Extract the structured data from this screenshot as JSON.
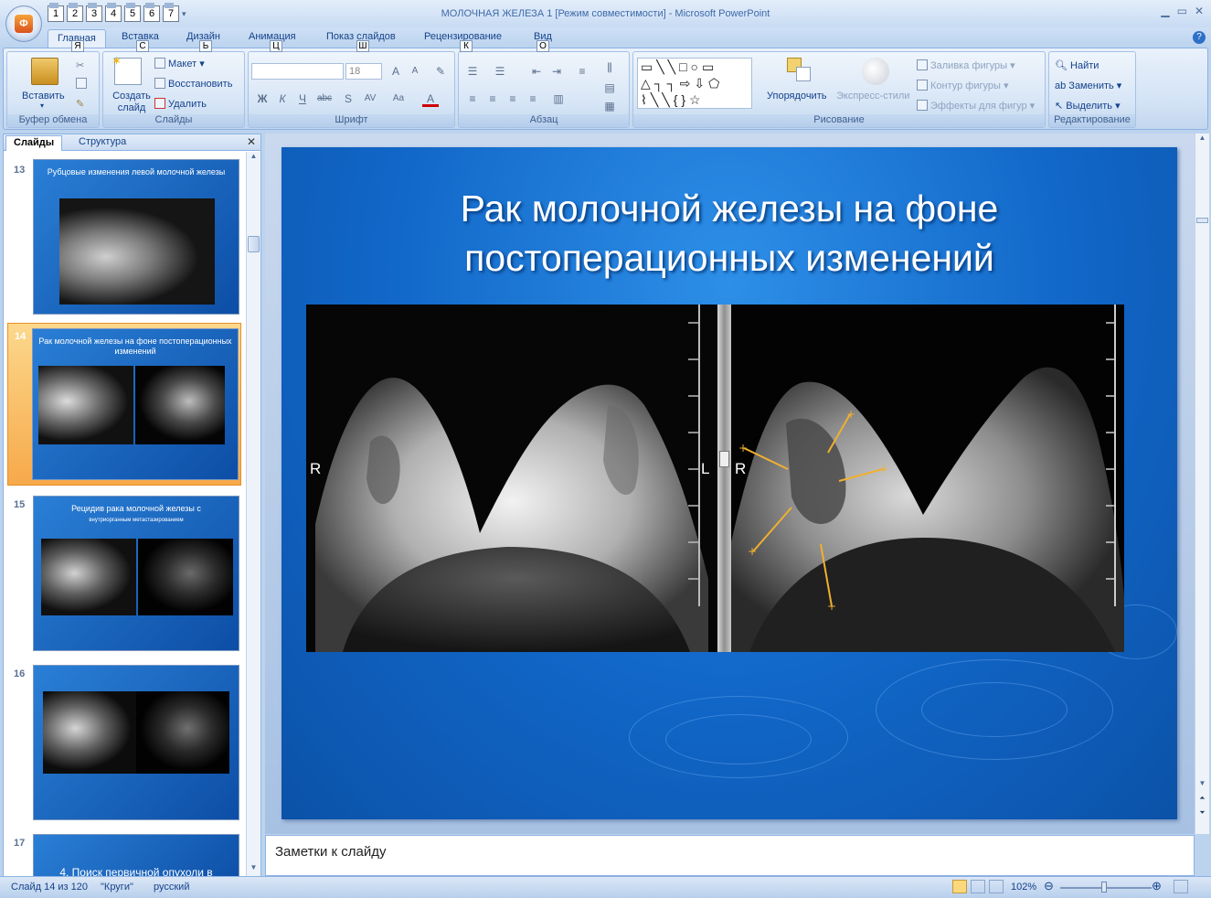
{
  "window": {
    "title": "МОЛОЧНАЯ ЖЕЛЕЗА 1 [Режим совместимости] - Microsoft PowerPoint"
  },
  "qat": {
    "keys": [
      "1",
      "2",
      "3",
      "4",
      "5",
      "6",
      "7"
    ]
  },
  "tabs": [
    {
      "label": "Главная",
      "key": "Я",
      "active": true
    },
    {
      "label": "Вставка",
      "key": "С"
    },
    {
      "label": "Дизайн",
      "key": "Ь"
    },
    {
      "label": "Анимация",
      "key": "Ц"
    },
    {
      "label": "Показ слайдов",
      "key": "Ш"
    },
    {
      "label": "Рецензирование",
      "key": "К"
    },
    {
      "label": "Вид",
      "key": "О"
    }
  ],
  "ribbon": {
    "clipboard": {
      "paste": "Вставить",
      "label": "Буфер обмена"
    },
    "slides": {
      "new_slide": "Создать слайд",
      "layout": "Макет",
      "reset": "Восстановить",
      "delete": "Удалить",
      "label": "Слайды"
    },
    "font": {
      "size": "18",
      "label": "Шрифт"
    },
    "paragraph": {
      "label": "Абзац"
    },
    "drawing": {
      "arrange": "Упорядочить",
      "quick_styles": "Экспресс-стили",
      "fill": "Заливка фигуры",
      "outline": "Контур фигуры",
      "effects": "Эффекты для фигур",
      "label": "Рисование"
    },
    "editing": {
      "find": "Найти",
      "replace": "Заменить",
      "select": "Выделить",
      "label": "Редактирование"
    }
  },
  "panel": {
    "tab_slides": "Слайды",
    "tab_outline": "Структура"
  },
  "thumbnails": [
    {
      "num": "13",
      "title": "Рубцовые изменения левой молочной железы"
    },
    {
      "num": "14",
      "title": "Рак молочной железы на фоне постоперационных изменений",
      "selected": true
    },
    {
      "num": "15",
      "title": "Рецидив рака молочной железы с",
      "subtitle": "внутриорганным метастазированием"
    },
    {
      "num": "16",
      "title": ""
    },
    {
      "num": "17",
      "title": "4. Поиск первичной опухоли в"
    }
  ],
  "slide": {
    "title_line1": "Рак молочной железы на фоне",
    "title_line2": "постоперационных изменений",
    "left_label_r": "R",
    "left_label_l": "L",
    "right_label_r": "R"
  },
  "notes": {
    "placeholder": "Заметки к слайду"
  },
  "status": {
    "slide": "Слайд 14 из 120",
    "theme": "\"Круги\"",
    "lang": "русский",
    "zoom": "102%"
  }
}
